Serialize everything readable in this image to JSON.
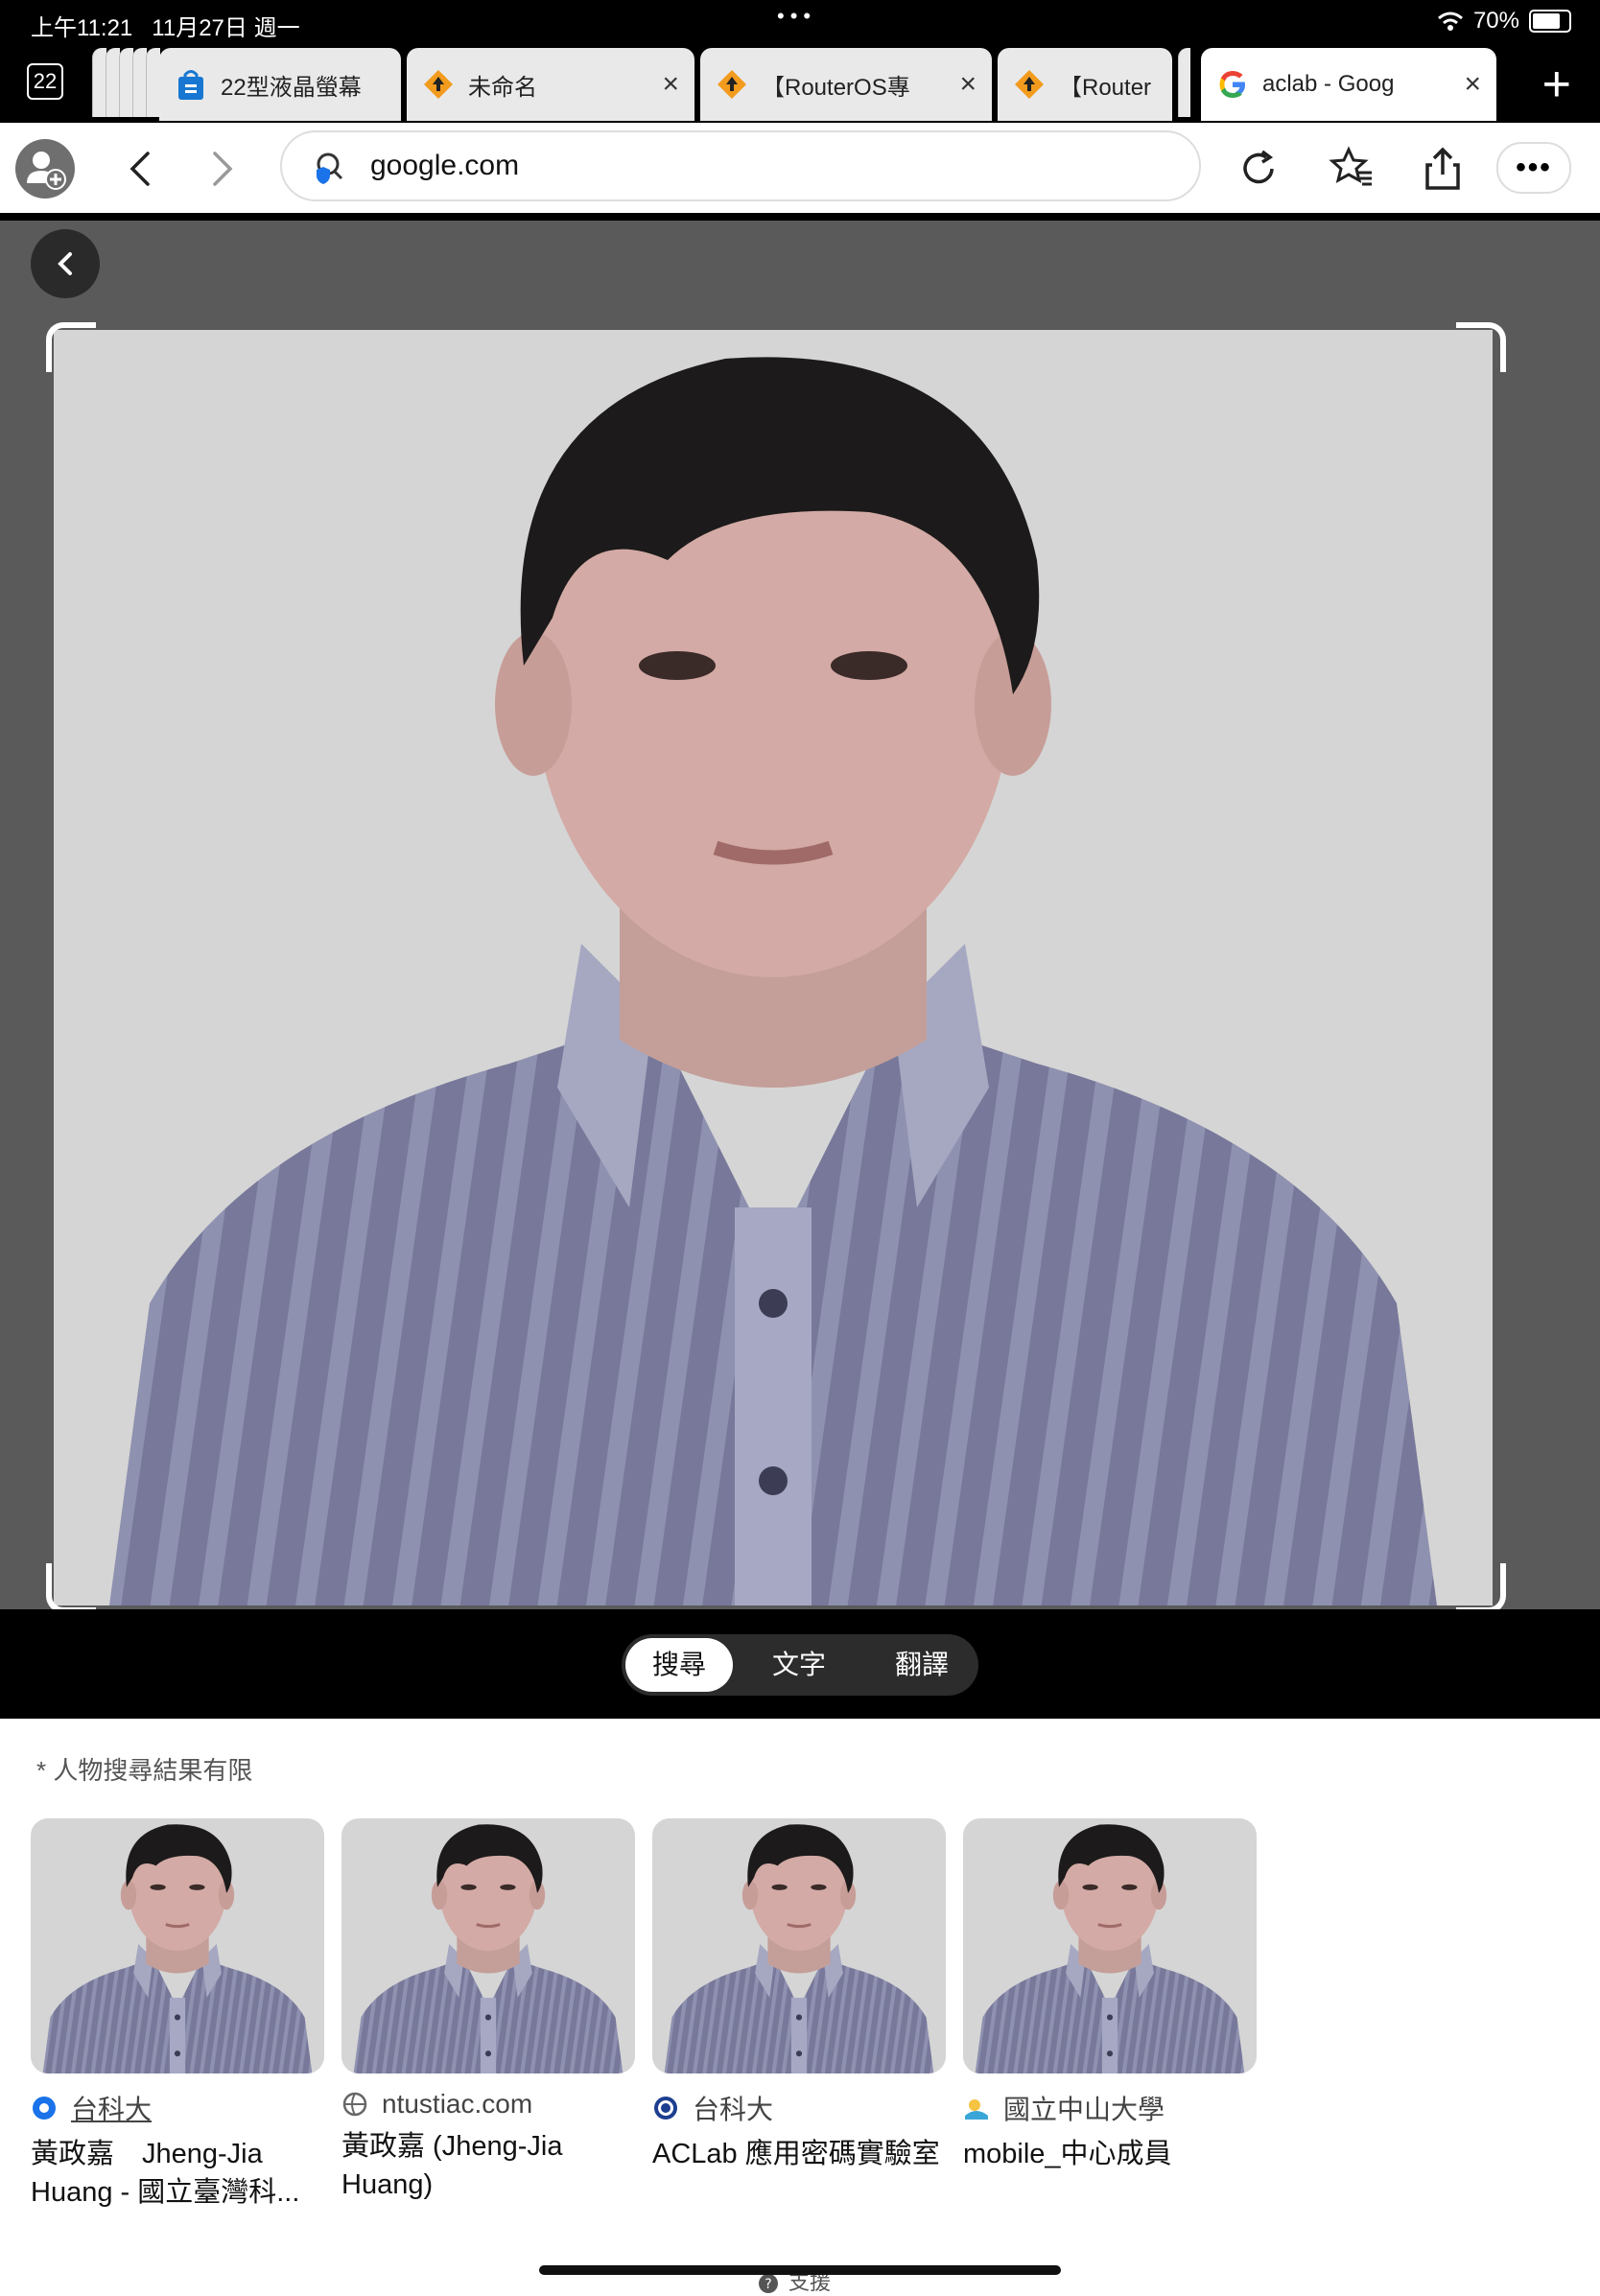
{
  "status_bar": {
    "time": "上午11:21",
    "date": "11月27日 週一",
    "battery": "70%",
    "battery_level": 0.7
  },
  "tab_bar": {
    "tab_count": "22",
    "tabs": [
      {
        "label": "22型液晶螢幕",
        "icon": "shopping-bag-icon"
      },
      {
        "label": "未命名",
        "icon": "routeros-icon"
      },
      {
        "label": "【RouterOS專",
        "icon": "routeros-icon"
      },
      {
        "label": "【Router",
        "icon": "routeros-icon"
      },
      {
        "label": "aclab - Goog",
        "icon": "google-icon",
        "active": true
      }
    ]
  },
  "toolbar": {
    "url": "google.com"
  },
  "lens": {
    "modes": [
      "搜尋",
      "文字",
      "翻譯"
    ],
    "selected_mode": "搜尋"
  },
  "results": {
    "note": "* 人物搜尋結果有限",
    "items": [
      {
        "source": "台科大",
        "title": "黃政嘉　Jheng-Jia Huang - 國立臺灣科...",
        "linked": true
      },
      {
        "source": "ntustiac.com",
        "title": "黃政嘉 (Jheng-Jia Huang)",
        "linked": false
      },
      {
        "source": "台科大",
        "title": "ACLab 應用密碼實驗室",
        "linked": false
      },
      {
        "source": "國立中山大學",
        "title": "mobile_中心成員",
        "linked": false
      }
    ]
  },
  "footer": {
    "help": "支援"
  },
  "colors": {
    "accent_blue": "#1a73e8",
    "routeros_orange": "#f29b1d",
    "viewer_bg": "#5a5a5a"
  }
}
